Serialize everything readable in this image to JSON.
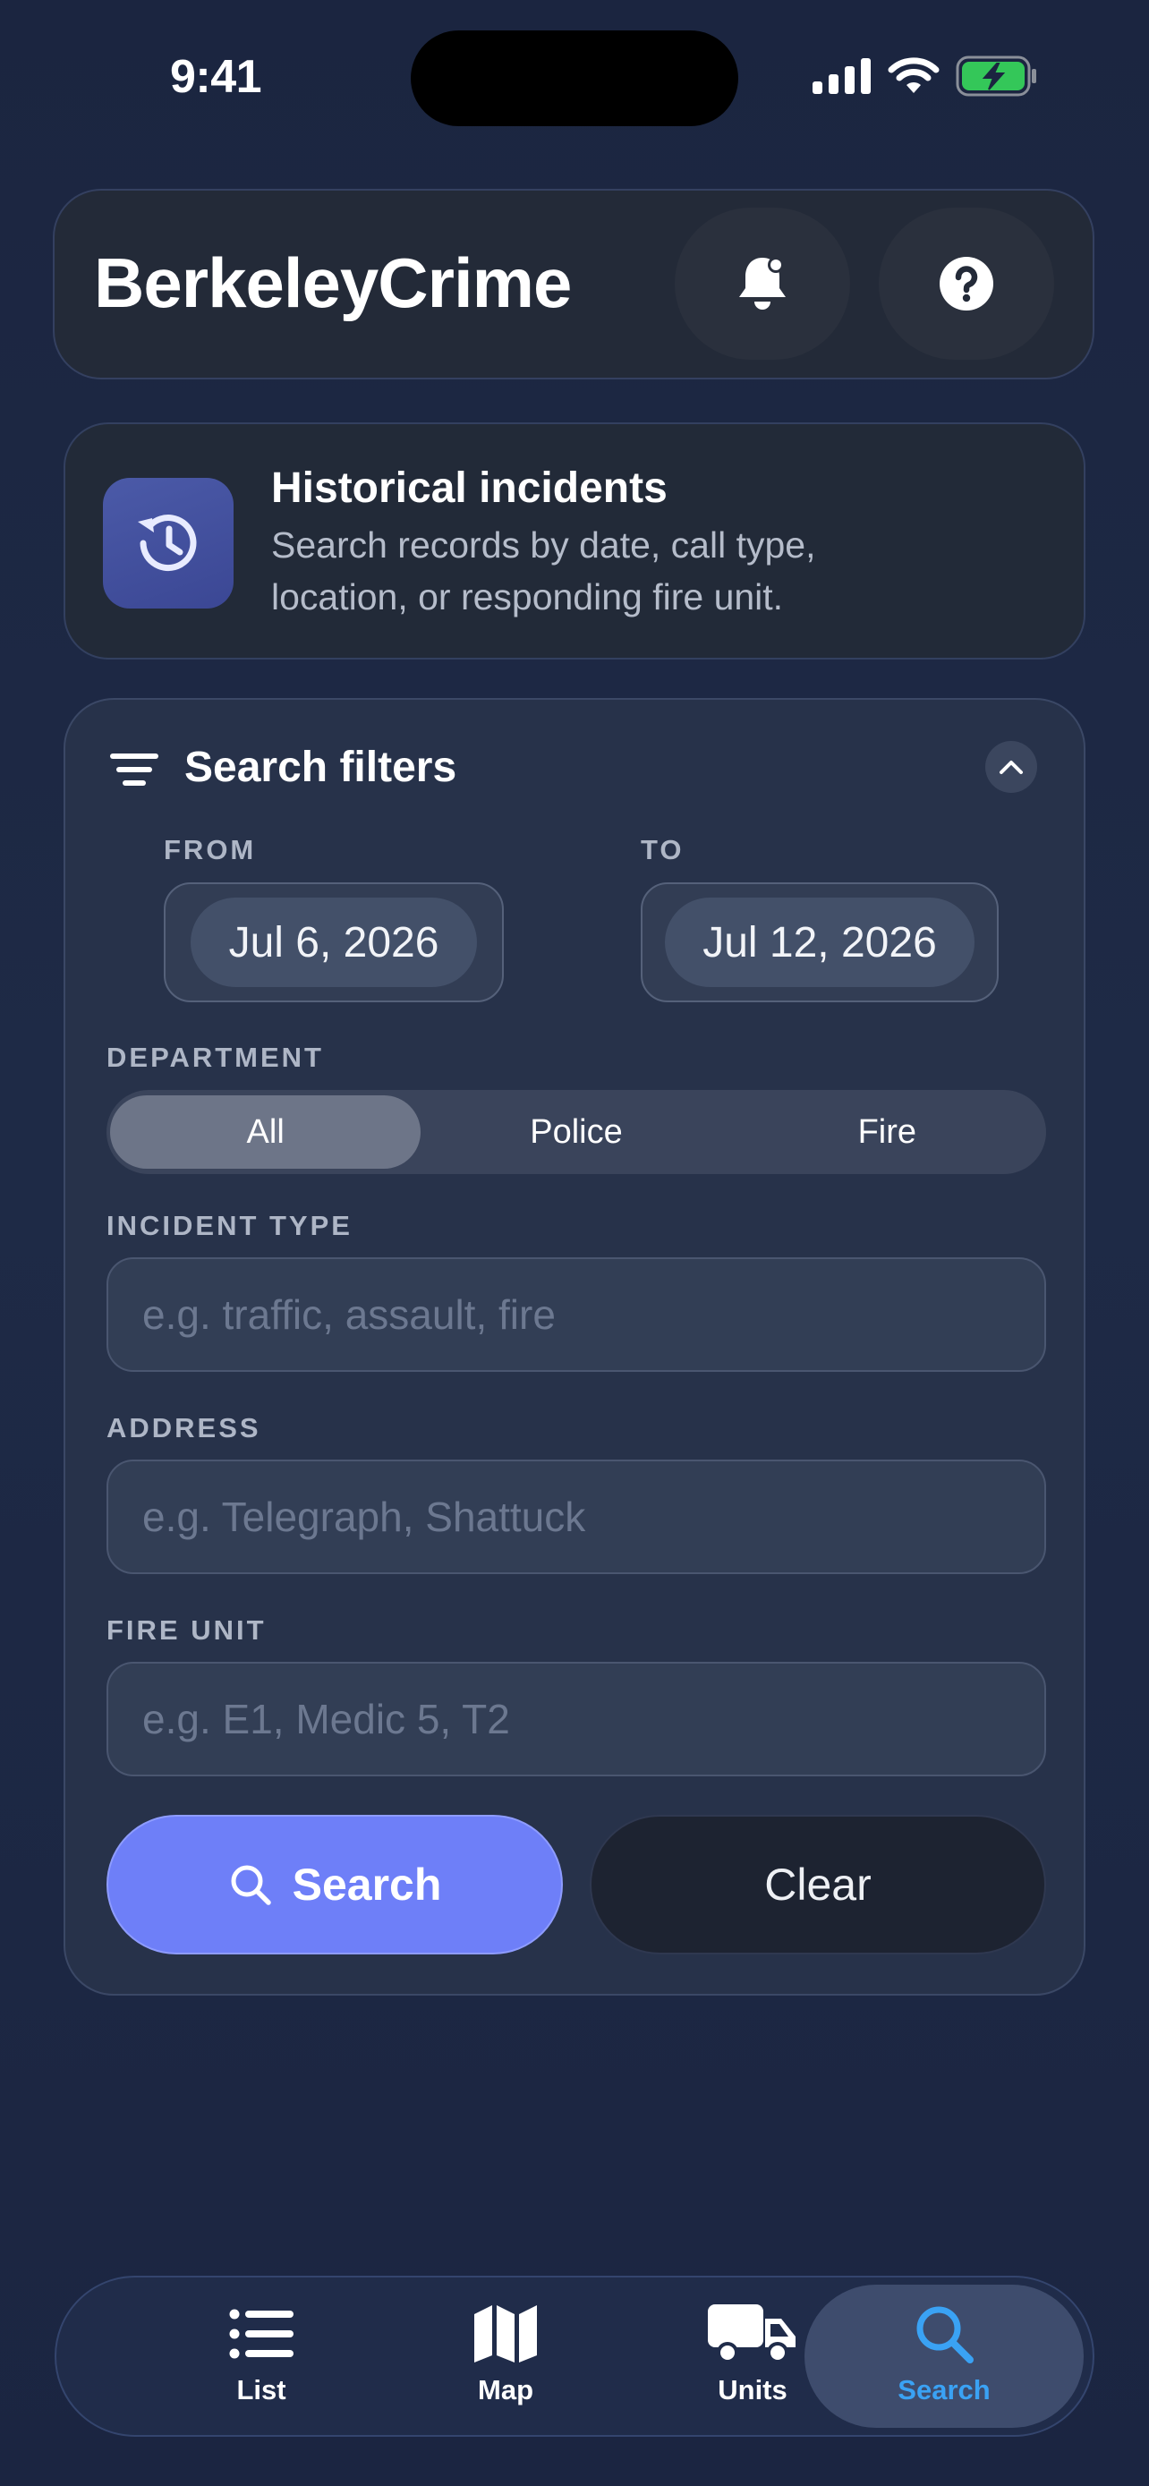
{
  "status_bar": {
    "time": "9:41"
  },
  "header": {
    "title": "BerkeleyCrime"
  },
  "info_card": {
    "title": "Historical incidents",
    "description": "Search records by date, call type, location, or responding fire unit."
  },
  "filters": {
    "title": "Search filters",
    "from_label": "FROM",
    "from_value": "Jul 6, 2026",
    "to_label": "TO",
    "to_value": "Jul 12, 2026",
    "department_label": "DEPARTMENT",
    "department_options": [
      "All",
      "Police",
      "Fire"
    ],
    "department_selected": "All",
    "incident_type_label": "INCIDENT TYPE",
    "incident_type_placeholder": "e.g. traffic, assault, fire",
    "incident_type_value": "",
    "address_label": "ADDRESS",
    "address_placeholder": "e.g. Telegraph, Shattuck",
    "address_value": "",
    "fire_unit_label": "FIRE UNIT",
    "fire_unit_placeholder": "e.g. E1, Medic 5, T2",
    "fire_unit_value": "",
    "search_label": "Search",
    "clear_label": "Clear"
  },
  "tabbar": {
    "items": [
      {
        "label": "List",
        "icon": "list-icon"
      },
      {
        "label": "Map",
        "icon": "map-icon"
      },
      {
        "label": "Units",
        "icon": "truck-icon"
      },
      {
        "label": "Search",
        "icon": "search-icon"
      }
    ],
    "active": "Search"
  },
  "colors": {
    "accent": "#6e7ff8",
    "active_tab": "#3aa2f4",
    "battery": "#34c759",
    "background": "#1e2a46"
  }
}
